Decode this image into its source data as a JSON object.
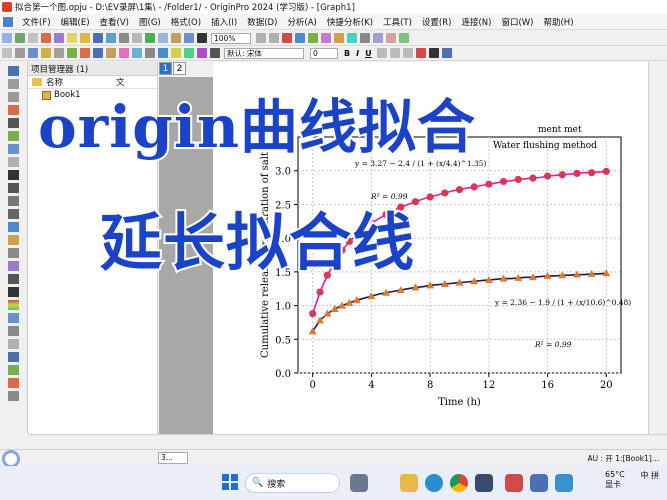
{
  "window": {
    "title": "拟合第一个图.opju - D:\\EV录屏\\1集\\ - /Folder1/ - OriginPro 2024 (学习版) - [Graph1]"
  },
  "menu": [
    "文件(F)",
    "编辑(E)",
    "查看(V)",
    "图(G)",
    "格式(O)",
    "插入(I)",
    "数据(D)",
    "分析(A)",
    "快捷分析(K)",
    "工具(T)",
    "设置(R)",
    "连接(N)",
    "窗口(W)",
    "帮助(H)"
  ],
  "toolbar": {
    "zoom": "100%",
    "font": "默认: 宋体",
    "font_size": "0"
  },
  "project_manager": {
    "title": "项目管理器 (1)",
    "column_name": "名称",
    "column_extra": "文",
    "items": [
      "Book1"
    ]
  },
  "layer_tabs": [
    "1",
    "2"
  ],
  "overlay": {
    "line1": "origin曲线拟合",
    "line2": "延长拟合线"
  },
  "chart_data": {
    "type": "scatter",
    "xlabel": "Time (h)",
    "ylabel": "Cumulative release concentration of salt",
    "xticks": [
      "0",
      "4",
      "8",
      "12",
      "16",
      "20"
    ],
    "yticks": [
      "0.0",
      "0.5",
      "1.0",
      "1.5",
      "2.0",
      "2.5",
      "3.0"
    ],
    "xlim": [
      -1,
      21
    ],
    "ylim": [
      0,
      3.5
    ],
    "grid": true,
    "legend_text": [
      "ment met",
      "Water flushing method"
    ],
    "series": [
      {
        "marker": "circle",
        "color": "#d9365a",
        "x": [
          0,
          0.5,
          1,
          1.5,
          2,
          2.5,
          3,
          3.5,
          4,
          4.5,
          5,
          5.5,
          6,
          6.5,
          7,
          7.5,
          8,
          8.5,
          9,
          9.5,
          10,
          10.5,
          11,
          11.5,
          12,
          12.5,
          13,
          13.5,
          14,
          14.5,
          15,
          15.5,
          16,
          16.5,
          17,
          17.5,
          18,
          18.5,
          19,
          19.5,
          20
        ],
        "values": [
          0.88,
          1.2,
          1.45,
          1.65,
          1.82,
          1.95,
          2.05,
          2.14,
          2.22,
          2.29,
          2.35,
          2.41,
          2.46,
          2.5,
          2.54,
          2.58,
          2.61,
          2.64,
          2.67,
          2.7,
          2.72,
          2.74,
          2.76,
          2.78,
          2.8,
          2.82,
          2.84,
          2.85,
          2.87,
          2.88,
          2.89,
          2.9,
          2.92,
          2.93,
          2.94,
          2.95,
          2.96,
          2.97,
          2.97,
          2.98,
          2.99
        ],
        "fit_color": "#d61fb8",
        "equation": "y = 3.27 − 2.4 / (1 + (x/4.4)^1.35)",
        "r2": "R² = 0.99"
      },
      {
        "marker": "triangle",
        "color": "#e07a2a",
        "x": [
          0,
          0.5,
          1,
          1.5,
          2,
          2.5,
          3,
          3.5,
          4,
          4.5,
          5,
          5.5,
          6,
          6.5,
          7,
          7.5,
          8,
          8.5,
          9,
          9.5,
          10,
          10.5,
          11,
          11.5,
          12,
          12.5,
          13,
          13.5,
          14,
          14.5,
          15,
          15.5,
          16,
          16.5,
          17,
          17.5,
          18,
          18.5,
          19,
          19.5,
          20
        ],
        "values": [
          0.62,
          0.78,
          0.88,
          0.95,
          1.0,
          1.04,
          1.08,
          1.11,
          1.14,
          1.17,
          1.19,
          1.21,
          1.23,
          1.25,
          1.27,
          1.28,
          1.3,
          1.31,
          1.32,
          1.33,
          1.34,
          1.35,
          1.36,
          1.37,
          1.38,
          1.39,
          1.4,
          1.4,
          1.41,
          1.42,
          1.42,
          1.43,
          1.44,
          1.44,
          1.45,
          1.45,
          1.46,
          1.46,
          1.47,
          1.47,
          1.48
        ],
        "fit_color": "#1a1a5a",
        "equation": "y = 2.36 − 1.9 / (1 + (x/10.6)^0.48)",
        "r2": "R² = 0.99"
      }
    ]
  },
  "status": {
    "tab": "3...",
    "right": "AU : 开  1:[Book1]..."
  },
  "taskbar": {
    "search": "搜索",
    "weather_temp": "65°C",
    "weather_desc": "显卡",
    "ime": "中",
    "layout": "拼"
  }
}
